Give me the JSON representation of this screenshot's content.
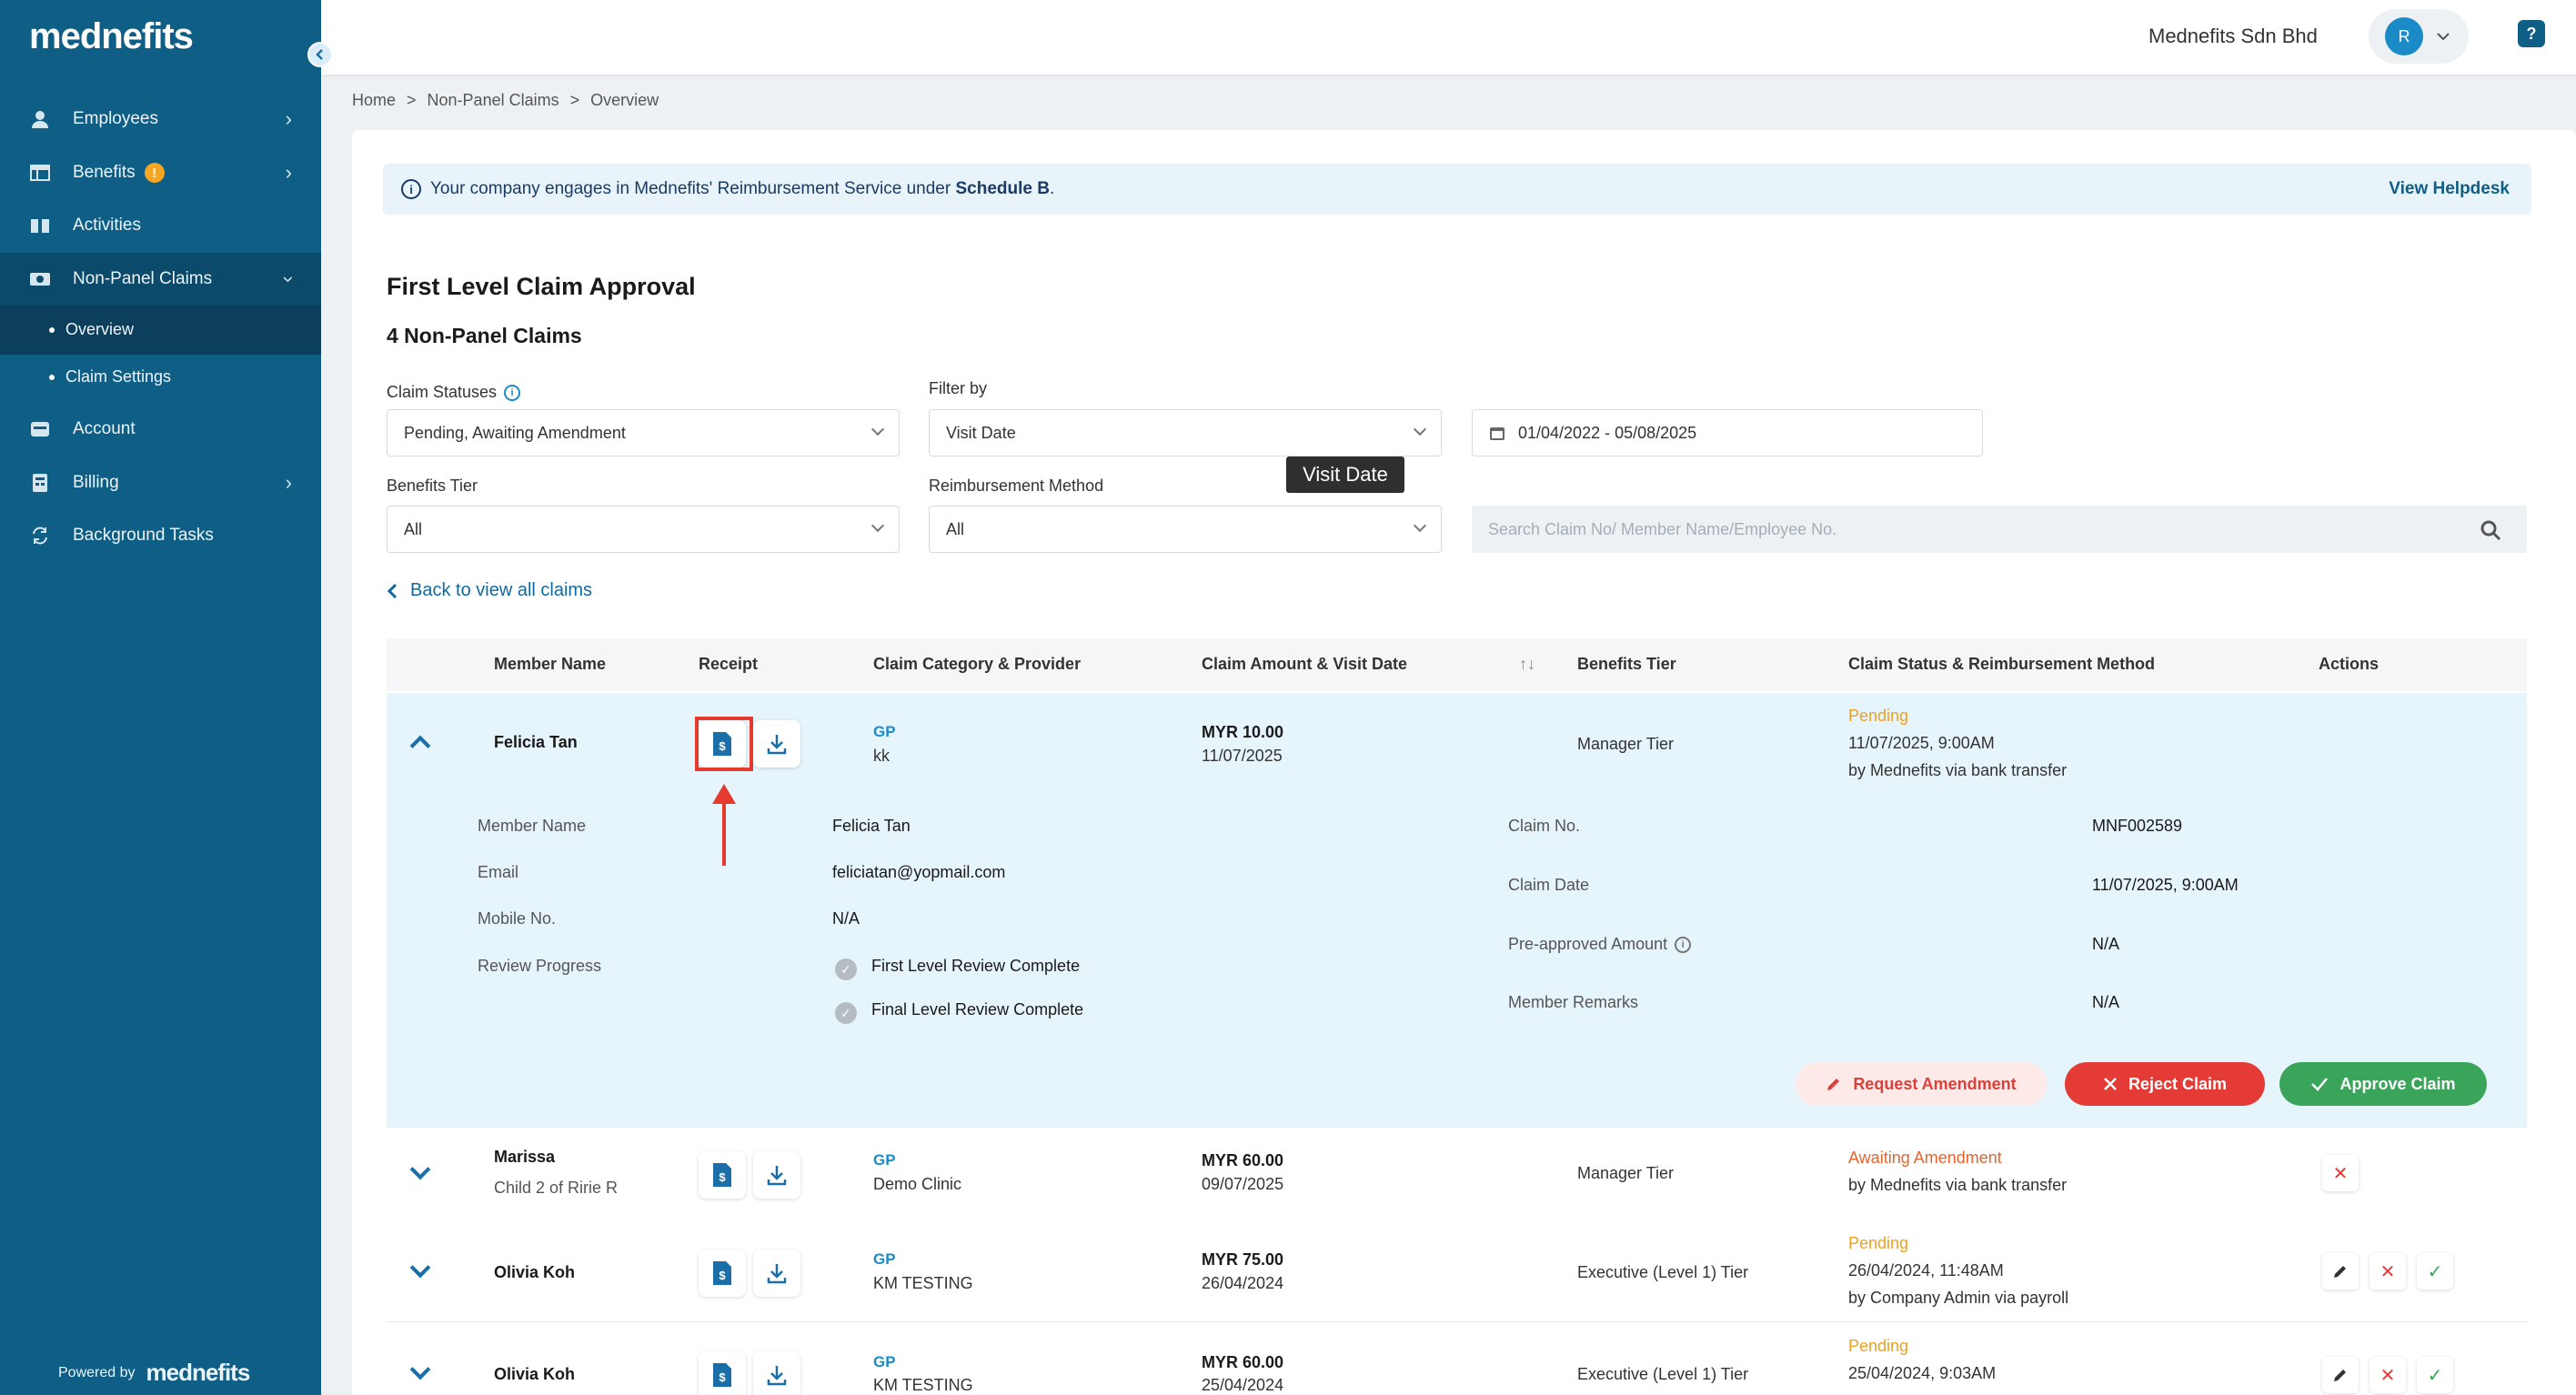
{
  "sidebar": {
    "logo": "mednefits",
    "items": [
      {
        "label": "Employees",
        "icon": "person-icon"
      },
      {
        "label": "Benefits",
        "icon": "table-icon",
        "badge": "!"
      },
      {
        "label": "Activities",
        "icon": "book-icon"
      },
      {
        "label": "Non-Panel Claims",
        "icon": "money-icon"
      },
      {
        "label": "Account",
        "icon": "account-icon"
      },
      {
        "label": "Billing",
        "icon": "billing-icon"
      },
      {
        "label": "Background Tasks",
        "icon": "sync-icon"
      }
    ],
    "sub_items": [
      {
        "label": "Overview"
      },
      {
        "label": "Claim Settings"
      }
    ],
    "powered_by": "Powered by",
    "powered_logo": "mednefits"
  },
  "topbar": {
    "company": "Mednefits Sdn Bhd",
    "avatar_initial": "R",
    "help": "?"
  },
  "breadcrumb": [
    "Home",
    ">",
    "Non-Panel Claims",
    ">",
    "Overview"
  ],
  "info": {
    "text": "Your company engages in Mednefits' Reimbursement Service under ",
    "schedule": "Schedule B",
    "period": ".",
    "link": "View Helpdesk"
  },
  "page": {
    "title": "First Level Claim Approval",
    "subtitle": "4 Non-Panel Claims"
  },
  "filters": {
    "claim_statuses_label": "Claim Statuses",
    "claim_statuses_value": "Pending, Awaiting Amendment",
    "filter_by_label": "Filter by",
    "filter_by_value": "Visit Date",
    "date_range": "01/04/2022 - 05/08/2025",
    "benefits_tier_label": "Benefits Tier",
    "benefits_tier_value": "All",
    "reimb_label": "Reimbursement Method",
    "reimb_value": "All",
    "search_placeholder": "Search Claim No/ Member Name/Employee No.",
    "tooltip": "Visit Date"
  },
  "back_link": "Back to view all claims",
  "table": {
    "headers": {
      "member": "Member Name",
      "receipt": "Receipt",
      "category": "Claim Category & Provider",
      "amount": "Claim Amount & Visit Date",
      "tier": "Benefits Tier",
      "status": "Claim Status & Reimbursement Method",
      "actions": "Actions"
    },
    "rows": [
      {
        "name": "Felicia Tan",
        "sub": "",
        "cat": "GP",
        "provider": "kk",
        "amount": "MYR 10.00",
        "date": "11/07/2025",
        "tier": "Manager Tier",
        "status": "Pending",
        "status_date": "11/07/2025, 9:00AM",
        "method": "by Mednefits via bank transfer"
      },
      {
        "name": "Marissa",
        "sub": "Child 2 of Ririe R",
        "cat": "GP",
        "provider": "Demo Clinic",
        "amount": "MYR 60.00",
        "date": "09/07/2025",
        "tier": "Manager Tier",
        "status": "Awaiting Amendment",
        "status_date": "",
        "method": "by Mednefits via bank transfer"
      },
      {
        "name": "Olivia Koh",
        "sub": "",
        "cat": "GP",
        "provider": "KM TESTING",
        "amount": "MYR 75.00",
        "date": "26/04/2024",
        "tier": "Executive (Level 1) Tier",
        "status": "Pending",
        "status_date": "26/04/2024, 11:48AM",
        "method": "by Company Admin via payroll"
      },
      {
        "name": "Olivia Koh",
        "sub": "",
        "cat": "GP",
        "provider": "KM TESTING",
        "amount": "MYR 60.00",
        "date": "25/04/2024",
        "tier": "Executive (Level 1) Tier",
        "status": "Pending",
        "status_date": "25/04/2024, 9:03AM",
        "method": ""
      }
    ]
  },
  "details": {
    "member_name_label": "Member Name",
    "member_name": "Felicia Tan",
    "email_label": "Email",
    "email": "feliciatan@yopmail.com",
    "mobile_label": "Mobile No.",
    "mobile": "N/A",
    "review_label": "Review Progress",
    "review_1": "First Level Review Complete",
    "review_2": "Final Level Review Complete",
    "claim_no_label": "Claim No.",
    "claim_no": "MNF002589",
    "claim_date_label": "Claim Date",
    "claim_date": "11/07/2025, 9:00AM",
    "preapproved_label": "Pre-approved Amount",
    "preapproved": "N/A",
    "remarks_label": "Member Remarks",
    "remarks": "N/A"
  },
  "buttons": {
    "request": "Request Amendment",
    "reject": "Reject Claim",
    "approve": "Approve Claim"
  }
}
